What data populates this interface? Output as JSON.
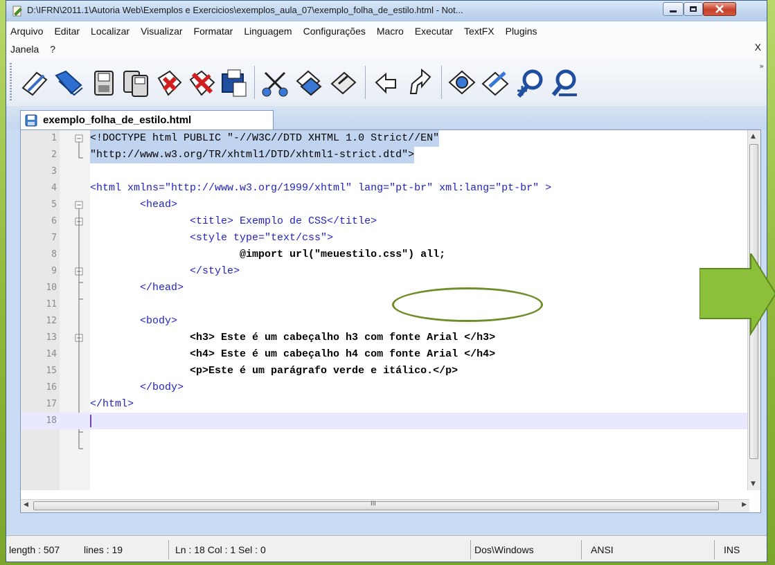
{
  "window": {
    "title": "D:\\IFRN\\2011.1\\Autoria Web\\Exemplos e Exercicios\\exemplos_aula_07\\exemplo_folha_de_estilo.html - Not..."
  },
  "menu": {
    "row1": [
      "Arquivo",
      "Editar",
      "Localizar",
      "Visualizar",
      "Formatar",
      "Linguagem",
      "Configurações",
      "Macro",
      "Executar",
      "TextFX",
      "Plugins"
    ],
    "row2": [
      "Janela",
      "?"
    ],
    "close_doc": "X"
  },
  "toolbar": {
    "buttons": [
      "new-file-icon",
      "open-folder-icon",
      "save-icon",
      "save-all-icon",
      "close-icon",
      "close-all-icon",
      "print-icon",
      "cut-icon",
      "copy-icon",
      "paste-icon",
      "undo-icon",
      "redo-icon",
      "find-icon",
      "replace-icon",
      "zoom-in-icon",
      "zoom-out-icon"
    ],
    "more": "»"
  },
  "tab": {
    "label": "exemplo_folha_de_estilo.html"
  },
  "editor": {
    "line_numbers": [
      "1",
      "2",
      "3",
      "4",
      "5",
      "6",
      "7",
      "8",
      "9",
      "10",
      "11",
      "12",
      "13",
      "14",
      "15",
      "16",
      "17",
      "18"
    ],
    "lines": [
      "<!DOCTYPE html PUBLIC \"-//W3C//DTD XHTML 1.0 Strict//EN\"",
      "\"http://www.w3.org/TR/xhtml1/DTD/xhtml1-strict.dtd\">",
      "",
      "<html xmlns=\"http://www.w3.org/1999/xhtml\" lang=\"pt-br\" xml:lang=\"pt-br\" >",
      "        <head>",
      "                <title> Exemplo de CSS</title>",
      "                <style type=\"text/css\">",
      "                        @import url(\"meuestilo.css\") all;",
      "                </style>",
      "        </head>",
      "",
      "        <body>",
      "                <h3> Este é um cabeçalho h3 com fonte Arial </h3>",
      "                <h4> Este é um cabeçalho h4 com fonte Arial </h4>",
      "                <p>Este é um parágrafo verde e itálico.</p>",
      "        </body>",
      "</html>",
      ""
    ],
    "hscroll_label": "III"
  },
  "status": {
    "length": "length : 507",
    "lines": "lines : 19",
    "position": "Ln : 18    Col : 1    Sel : 0",
    "eol": "Dos\\Windows",
    "encoding": "ANSI",
    "mode": "INS"
  },
  "colors": {
    "tag": "#1f1fc7",
    "attr": "#e01212",
    "string": "#8a1ab0",
    "accent_green": "#8fb83a"
  }
}
